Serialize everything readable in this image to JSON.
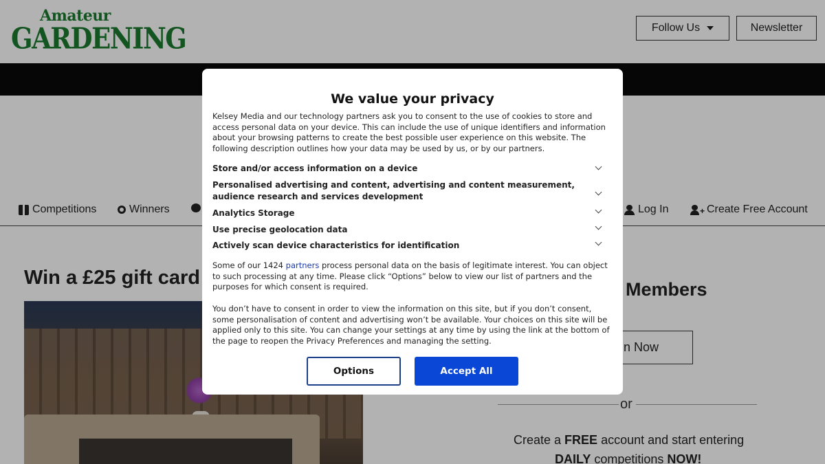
{
  "header": {
    "logo_small": "Amateur",
    "logo_big": "GARDENING",
    "follow_label": "Follow Us",
    "newsletter_label": "Newsletter"
  },
  "nav": {
    "items": [
      {
        "label": "Competitions",
        "icon": "gift-icon"
      },
      {
        "label": "Winners",
        "icon": "medal-icon"
      },
      {
        "label": "",
        "icon": "comment-icon"
      },
      {
        "label": "Log In",
        "icon": "user-icon"
      },
      {
        "label": "Create Free Account",
        "icon": "user-plus-icon"
      }
    ]
  },
  "main": {
    "competition_title": "Win a £25 gift card",
    "members_title": "Members",
    "join_label": "n Now",
    "or_text": "or",
    "create_prefix": "Create a ",
    "create_strong": "FREE",
    "create_suffix": " account and start entering",
    "daily_strong": "DAILY",
    "daily_middle": " competitions ",
    "daily_now": "NOW!"
  },
  "consent": {
    "title": "We value your privacy",
    "intro": "Kelsey Media and our technology partners ask you to consent to the use of cookies to store and access personal data on your device. This can include the use of unique identifiers and information about your browsing patterns to create the best possible user experience on this website. The following description outlines how your data may be used by us, or by our partners.",
    "purposes": [
      "Store and/or access information on a device",
      "Personalised advertising and content, advertising and content measurement, audience research and services development",
      "Analytics Storage",
      "Use precise geolocation data",
      "Actively scan device characteristics for identification"
    ],
    "legit_prefix": "Some of our 1424 ",
    "legit_link": "partners",
    "legit_suffix": " process personal data on the basis of legitimate interest. You can object to such processing at any time. Please click “Options” below to view our list of partners and the purposes for which consent is required.",
    "no_consent": "You don’t have to consent in order to view the information on this site, but if you don’t consent, some personalisation of content and advertising won’t be available. Your choices on this site will be applied only to this site. You can change your settings at any time by using the link at the bottom of the page to reopen the Privacy Preferences and managing the setting.",
    "options_label": "Options",
    "accept_label": "Accept All"
  },
  "colors": {
    "brand_green": "#1c7a2e",
    "accept_blue": "#0b47d6",
    "link_blue": "#1c3aa9"
  }
}
